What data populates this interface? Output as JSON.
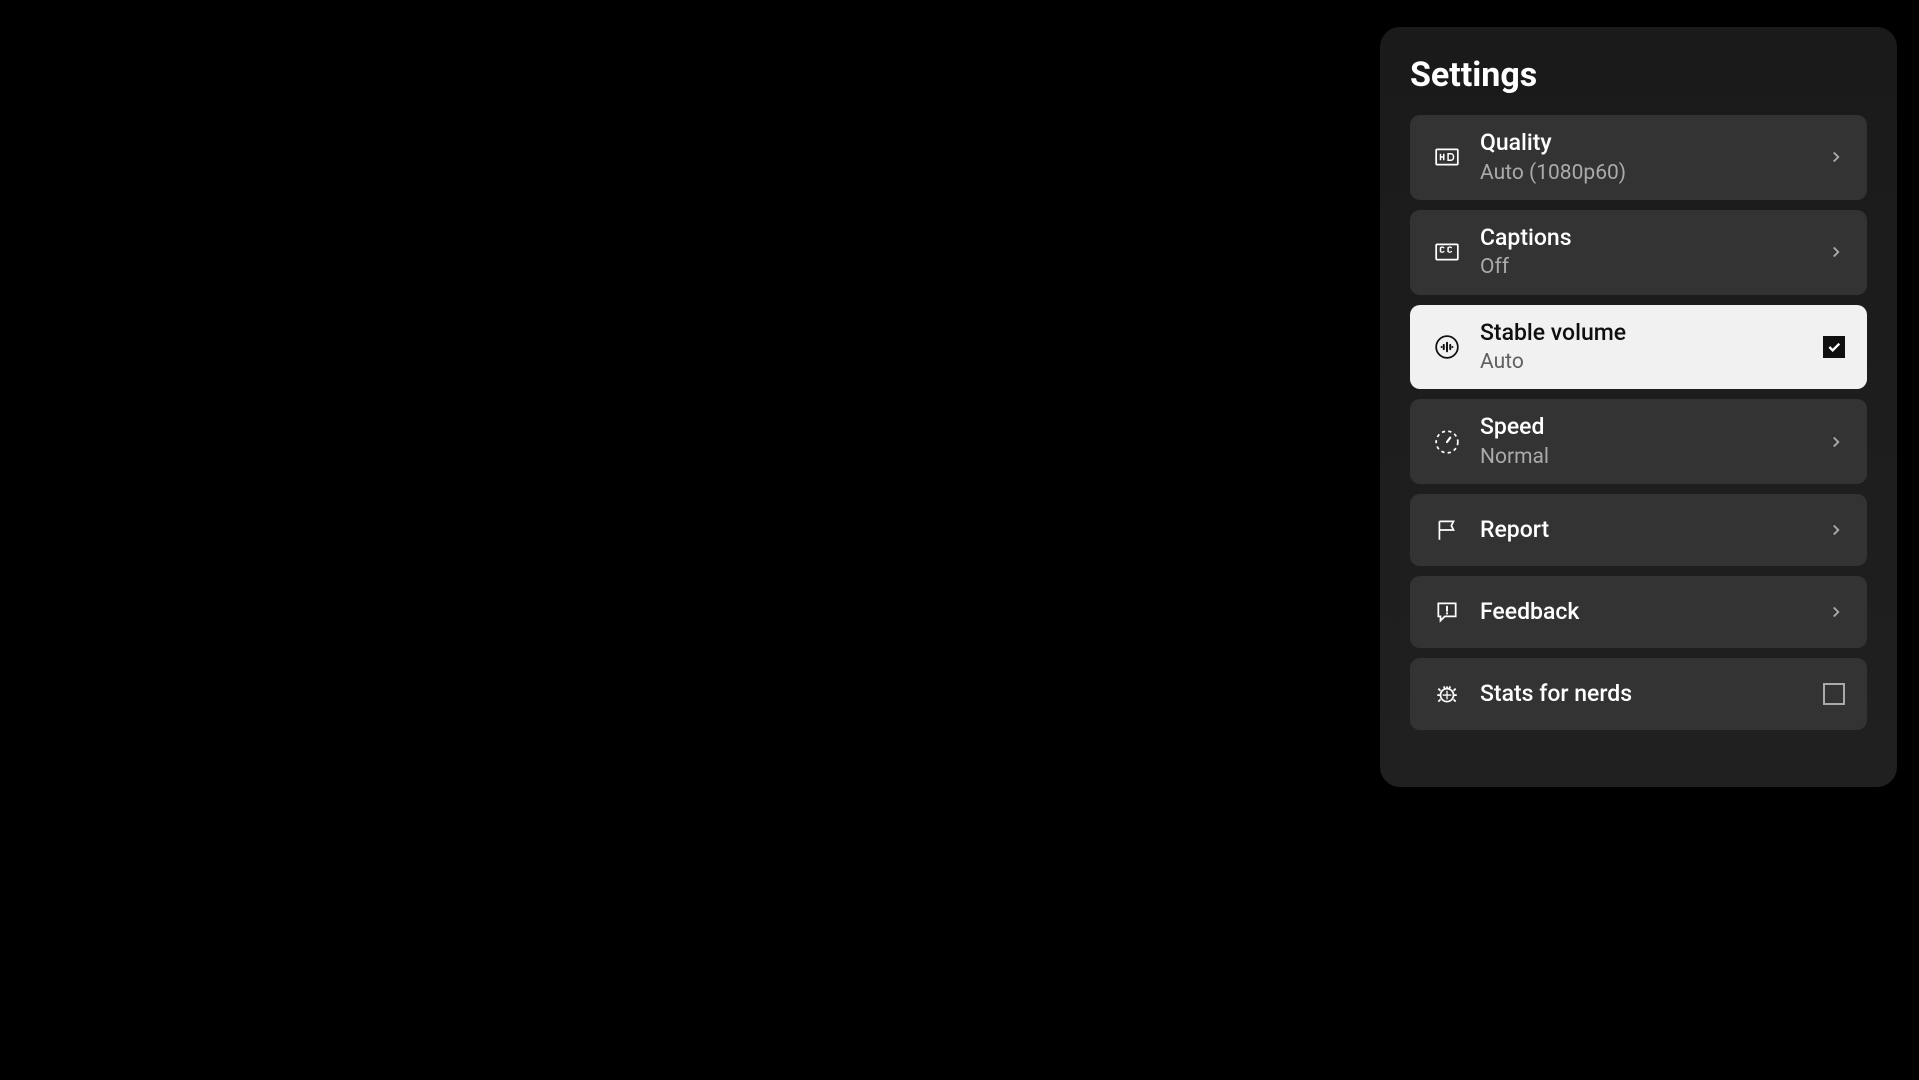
{
  "panel": {
    "title": "Settings"
  },
  "items": {
    "quality": {
      "title": "Quality",
      "subtitle": "Auto (1080p60)"
    },
    "captions": {
      "title": "Captions",
      "subtitle": "Off"
    },
    "stable_volume": {
      "title": "Stable volume",
      "subtitle": "Auto",
      "checked": true
    },
    "speed": {
      "title": "Speed",
      "subtitle": "Normal"
    },
    "report": {
      "title": "Report"
    },
    "feedback": {
      "title": "Feedback"
    },
    "stats": {
      "title": "Stats for nerds",
      "checked": false
    }
  }
}
